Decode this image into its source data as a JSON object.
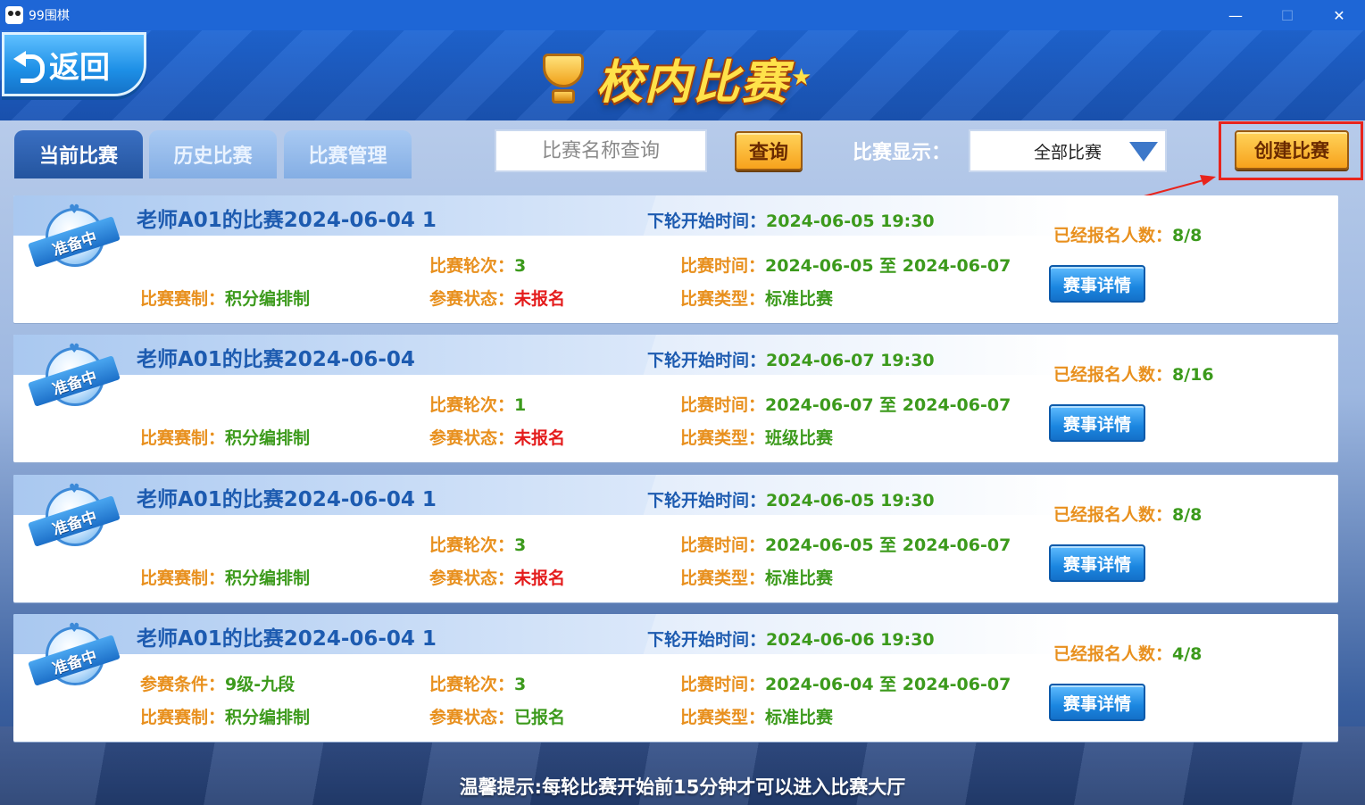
{
  "window": {
    "title": "99围棋",
    "minimize": "—",
    "maximize": "☐",
    "close": "✕"
  },
  "header": {
    "back_label": "返回",
    "page_title": "校内比赛"
  },
  "tabs": [
    {
      "label": "当前比赛",
      "active": true
    },
    {
      "label": "历史比赛",
      "active": false
    },
    {
      "label": "比赛管理",
      "active": false
    }
  ],
  "toolbar": {
    "search_placeholder": "比赛名称查询",
    "query_label": "查询",
    "display_label": "比赛显示：",
    "display_value": "全部比赛",
    "create_label": "创建比赛"
  },
  "labels": {
    "badge": "准备中",
    "next_round": "下轮开始时间：",
    "rounds": "比赛轮次：",
    "time": "比赛时间：",
    "format": "比赛赛制：",
    "status": "参赛状态：",
    "type": "比赛类型：",
    "enrolled": "已经报名人数：",
    "condition": "参赛条件：",
    "detail_button": "赛事详情"
  },
  "matches": [
    {
      "title": "老师A01的比赛2024-06-04 1",
      "next_round": "2024-06-05 19:30",
      "rounds": "3",
      "time": "2024-06-05 至 2024-06-07",
      "format": "积分编排制",
      "status": "未报名",
      "type": "标准比赛",
      "enrolled": "8/8",
      "condition": ""
    },
    {
      "title": "老师A01的比赛2024-06-04",
      "next_round": "2024-06-07 19:30",
      "rounds": "1",
      "time": "2024-06-07 至 2024-06-07",
      "format": "积分编排制",
      "status": "未报名",
      "type": "班级比赛",
      "enrolled": "8/16",
      "condition": ""
    },
    {
      "title": "老师A01的比赛2024-06-04 1",
      "next_round": "2024-06-05 19:30",
      "rounds": "3",
      "time": "2024-06-05 至 2024-06-07",
      "format": "积分编排制",
      "status": "未报名",
      "type": "标准比赛",
      "enrolled": "8/8",
      "condition": ""
    },
    {
      "title": "老师A01的比赛2024-06-04 1",
      "next_round": "2024-06-06 19:30",
      "rounds": "3",
      "time": "2024-06-04 至 2024-06-07",
      "format": "积分编排制",
      "status": "已报名",
      "type": "标准比赛",
      "enrolled": "4/8",
      "condition": "9级-九段"
    }
  ],
  "footer": {
    "tip": "温馨提示:每轮比赛开始前15分钟才可以进入比赛大厅"
  },
  "colors": {
    "accent_blue": "#1d5bb0",
    "label_orange": "#e8901e",
    "value_green": "#3c9a1c",
    "status_red": "#e41c1c",
    "highlight_red": "#e8241c"
  }
}
